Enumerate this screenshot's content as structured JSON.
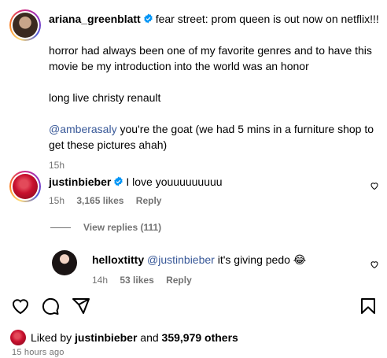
{
  "post": {
    "author": "ariana_greenblatt",
    "caption_lines": [
      "fear street: prom queen is out now on netflix!!!",
      "horror had always been one of my favorite genres and to have this movie be my introduction into the world was an honor",
      "long live christy renault"
    ],
    "mention": "@amberasaly",
    "mention_text": "you're the goat (we had 5 mins in a furniture shop to get these pictures ahah)",
    "time": "15h"
  },
  "comments": [
    {
      "user": "justinbieber",
      "text": "I love youuuuuuuuu",
      "time": "15h",
      "likes": "3,165 likes",
      "reply": "Reply",
      "view_replies": "View replies (111)"
    },
    {
      "user": "helloxtitty",
      "mention": "@justinbieber",
      "text": "it's giving pedo",
      "emoji": "😂",
      "time": "14h",
      "likes": "53 likes",
      "reply": "Reply"
    }
  ],
  "footer": {
    "liked_prefix": "Liked by",
    "liked_user": "justinbieber",
    "liked_and": "and",
    "liked_count": "359,979 others",
    "date": "15 hours ago"
  },
  "icons": [
    "heart-icon",
    "comment-icon",
    "share-icon",
    "bookmark-icon",
    "verified-icon"
  ],
  "colors": {
    "verified": "#0095f6",
    "mention": "#00376b",
    "muted": "#737373",
    "bieber_avatar": "#c8102e"
  }
}
